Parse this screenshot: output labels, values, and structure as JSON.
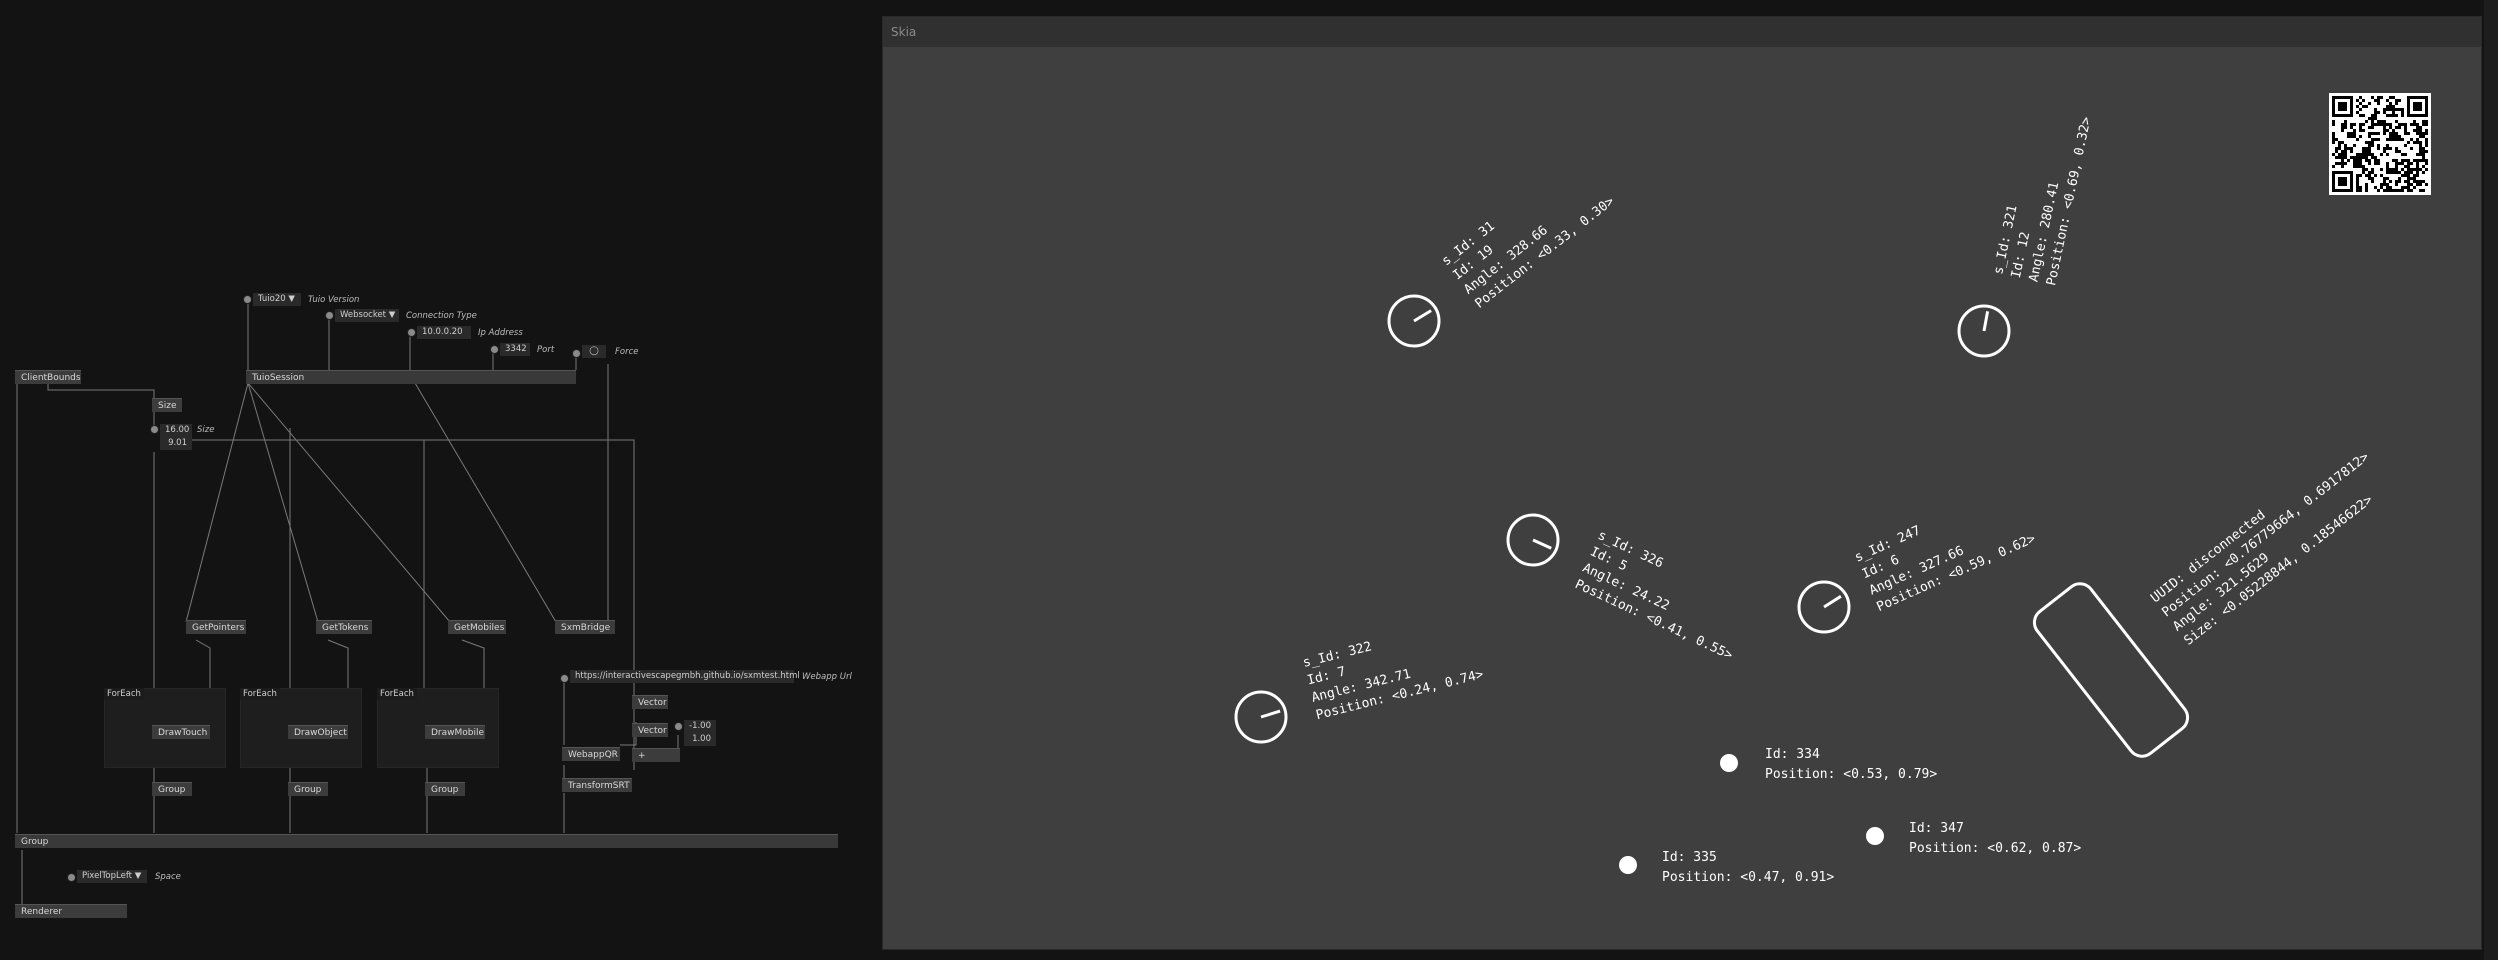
{
  "window": {
    "title": "Skia"
  },
  "patch": {
    "nodes": {
      "client_bounds": "ClientBounds",
      "size": "Size",
      "tuio_session": "TuioSession",
      "get_pointers": "GetPointers",
      "get_tokens": "GetTokens",
      "get_mobiles": "GetMobiles",
      "sxm_bridge": "SxmBridge",
      "draw_touch": "DrawTouch",
      "draw_object": "DrawObject",
      "draw_mobile": "DrawMobile",
      "group_1": "Group",
      "group_2": "Group",
      "group_3": "Group",
      "group_main": "Group",
      "webapp_qr": "WebappQR",
      "transform_srt": "TransformSRT",
      "vector_1": "Vector",
      "vector_2": "Vector",
      "plus": "+",
      "renderer": "Renderer"
    },
    "regions": {
      "foreach_1": "ForEach",
      "foreach_2": "ForEach",
      "foreach_3": "ForEach"
    },
    "ioboxes": {
      "tuio_version": {
        "value": "Tuio20 ▼",
        "label": "Tuio Version"
      },
      "connection_type": {
        "value": "Websocket ▼",
        "label": "Connection Type"
      },
      "ip_address": {
        "value": "10.0.0.20",
        "label": "Ip Address"
      },
      "port": {
        "value": "3342",
        "label": "Port"
      },
      "force": {
        "value": "◯",
        "label": "Force"
      },
      "size_x": {
        "value": "16.00",
        "label": "Size"
      },
      "size_y": {
        "value": "9.01"
      },
      "webapp_url": {
        "value": "https://interactivescapegmbh.github.io/sxmtest.html",
        "label": "Webapp Url"
      },
      "vec_x": {
        "value": "-1.00"
      },
      "vec_y": {
        "value": "1.00"
      },
      "space": {
        "value": "PixelTopLeft ▼",
        "label": "Space"
      }
    }
  },
  "skia_view": {
    "objects": [
      {
        "lines": [
          "s_Id: 31",
          "Id: 19",
          "Angle: 328.66",
          "Position: <0.33, 0.30>"
        ],
        "angle_deg": 328.66
      },
      {
        "lines": [
          "s_Id: 321",
          "Id: 12",
          "Angle: 280.41",
          "Position: <0.69, 0.32>"
        ],
        "angle_deg": 280.41
      },
      {
        "lines": [
          "s_Id: 326",
          "Id: 5",
          "Angle: 24.22",
          "Position: <0.41, 0.55>"
        ],
        "angle_deg": 24.22
      },
      {
        "lines": [
          "s_Id: 247",
          "Id: 6",
          "Angle: 327.66",
          "Position: <0.59, 0.62>"
        ],
        "angle_deg": 327.66
      },
      {
        "lines": [
          "s_Id: 322",
          "Id: 7",
          "Angle: 342.71",
          "Position: <0.24, 0.74>"
        ],
        "angle_deg": 342.71
      }
    ],
    "pointers": [
      {
        "lines": [
          "Id: 334",
          "Position: <0.53, 0.79>"
        ]
      },
      {
        "lines": [
          "Id: 335",
          "Position: <0.47, 0.91>"
        ]
      },
      {
        "lines": [
          "Id: 347",
          "Position: <0.62, 0.87>"
        ]
      }
    ],
    "mobile": {
      "lines": [
        "UUID: disconnected",
        "Position: <0.76779664, 0.6917812>",
        "Angle: 321.5629",
        "Size: <0.05228844, 0.18546622>"
      ],
      "angle_deg": 321.56
    },
    "qr_code_icon": "qr-code"
  }
}
